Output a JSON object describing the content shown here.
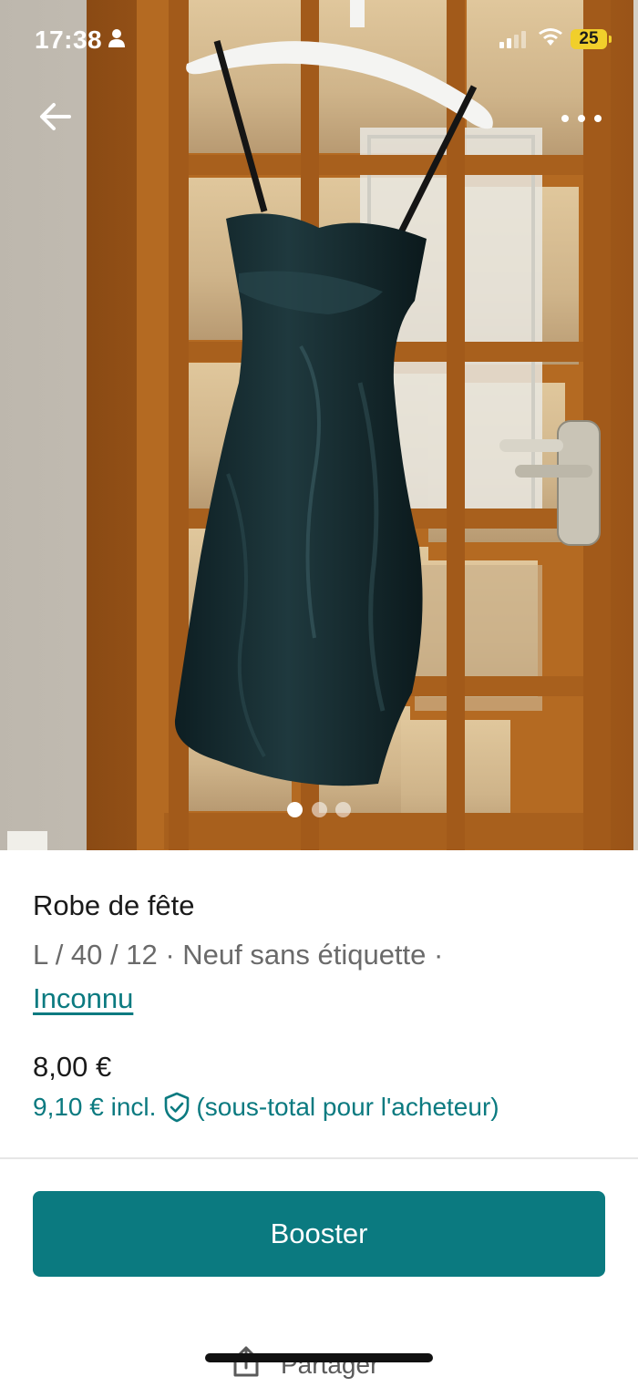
{
  "status_bar": {
    "time": "17:38",
    "battery": "25",
    "battery_color": "#f1cf2b"
  },
  "icons": {
    "back": "arrow-left-icon",
    "more": "more-horizontal-icon",
    "protection": "shield-check-icon",
    "share": "share-icon"
  },
  "gallery": {
    "image_count": 3,
    "active_index": 0
  },
  "item": {
    "title": "Robe de fête",
    "details": "L / 40 / 12 · Neuf sans étiquette ·",
    "brand": "Inconnu",
    "price": "8,00 €",
    "price_incl": "9,10 € incl.",
    "price_incl_note": "(sous-total pour l'acheteur)"
  },
  "actions": {
    "boost_label": "Booster",
    "share_label": "Partager"
  },
  "colors": {
    "accent": "#0b7a80",
    "text_primary": "#1a1a1a",
    "text_secondary": "#6a6a6a"
  }
}
